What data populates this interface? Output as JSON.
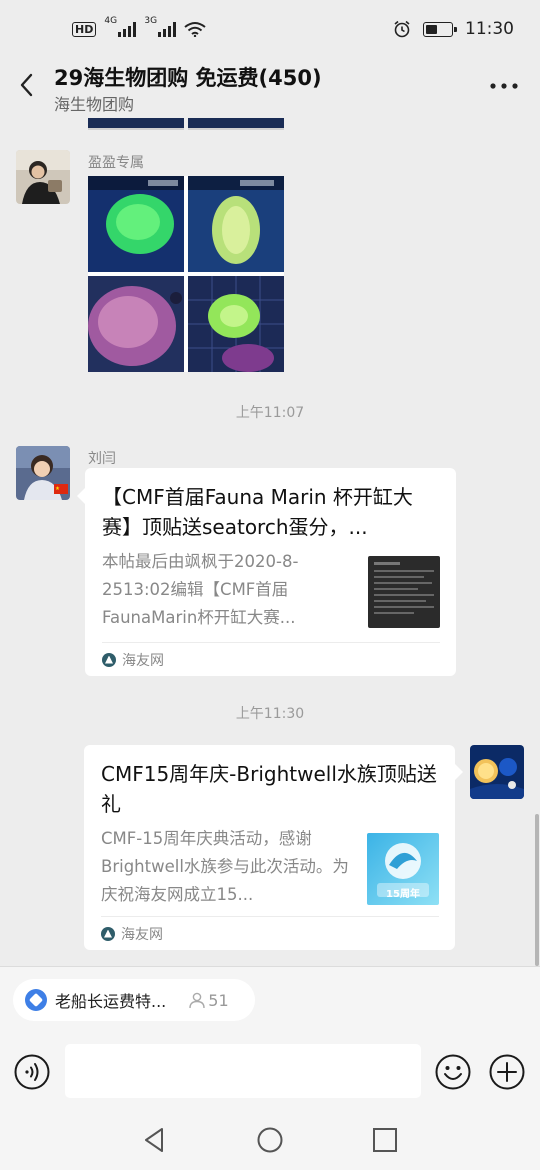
{
  "status_bar": {
    "hd_label": "HD",
    "signal1_label": "4G",
    "signal2_label": "3G",
    "battery_level": 0.45,
    "time": "11:30"
  },
  "header": {
    "title": "29海生物团购  免运费(450)",
    "subtitle": "海生物团购"
  },
  "messages": [
    {
      "type": "image_grid",
      "sender": "盈盈专属",
      "side": "left",
      "image_count": 4
    },
    {
      "type": "timestamp",
      "text": "上午11:07"
    },
    {
      "type": "link_card",
      "sender": "刘闫",
      "side": "left",
      "title": "【CMF首届Fauna Marin 杯开缸大赛】顶贴送seatorch蛋分，...",
      "desc": "本帖最后由飒枫于2020-8-2513:02编辑【CMF首届FaunaMarin杯开缸大赛...",
      "source": "海友网"
    },
    {
      "type": "timestamp",
      "text": "上午11:30"
    },
    {
      "type": "link_card",
      "sender": "",
      "side": "right",
      "title": "CMF15周年庆-Brightwell水族顶贴送礼",
      "desc": "CMF-15周年庆典活动，感谢Brightwell水族参与此次活动。为庆祝海友网成立15...",
      "source": "海友网",
      "thumb_text": "15周年"
    }
  ],
  "pinned": {
    "text": "老船长运费特...",
    "count": "51"
  },
  "input": {
    "value": "",
    "placeholder": ""
  },
  "colors": {
    "background": "#ededed",
    "card": "#ffffff",
    "accent_blue": "#3e7fe6",
    "muted_text": "#888888"
  },
  "icons": [
    "back-icon",
    "more-icon",
    "voice-icon",
    "emoji-icon",
    "plus-icon",
    "nav-back-icon",
    "nav-home-icon",
    "nav-recents-icon"
  ]
}
